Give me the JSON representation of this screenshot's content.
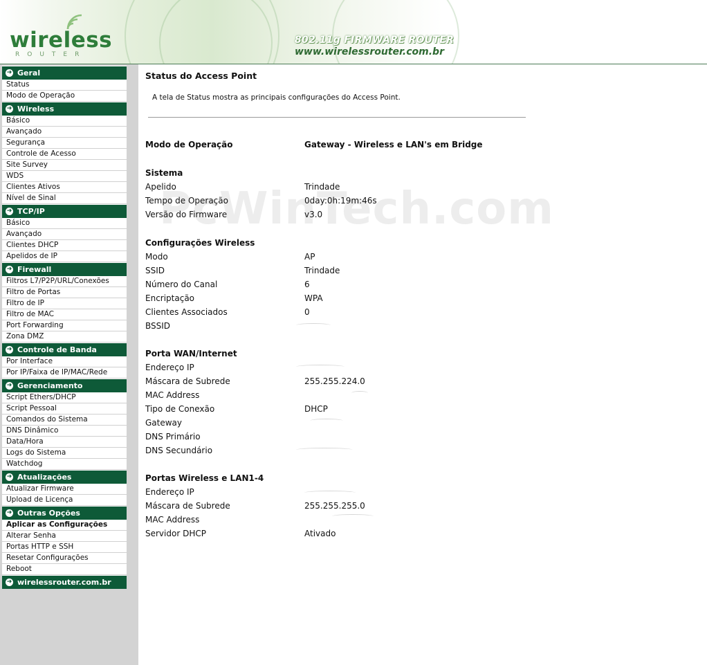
{
  "header": {
    "logo_word": "wireless",
    "logo_sub": "ROUTER",
    "firmware_title": "802.11g FIRMWARE ROUTER",
    "firmware_url": "www.wirelessrouter.com.br"
  },
  "sidebar": {
    "sections": [
      {
        "title": "Geral",
        "items": [
          "Status",
          "Modo de Operação"
        ]
      },
      {
        "title": "Wireless",
        "items": [
          "Básico",
          "Avançado",
          "Segurança",
          "Controle de Acesso",
          "Site Survey",
          "WDS",
          "Clientes Ativos",
          "Nível de Sinal"
        ]
      },
      {
        "title": "TCP/IP",
        "items": [
          "Básico",
          "Avançado",
          "Clientes DHCP",
          "Apelidos de IP"
        ]
      },
      {
        "title": "Firewall",
        "items": [
          "Filtros L7/P2P/URL/Conexões",
          "Filtro de Portas",
          "Filtro de IP",
          "Filtro de MAC",
          "Port Forwarding",
          "Zona DMZ"
        ]
      },
      {
        "title": "Controle de Banda",
        "items": [
          "Por Interface",
          "Por IP/Faixa de IP/MAC/Rede"
        ]
      },
      {
        "title": "Gerenciamento",
        "items": [
          "Script Ethers/DHCP",
          "Script Pessoal",
          "Comandos do Sistema",
          "DNS Dinâmico",
          "Data/Hora",
          "Logs do Sistema",
          "Watchdog"
        ]
      },
      {
        "title": "Atualizações",
        "items": [
          "Atualizar Firmware",
          "Upload de Licença"
        ]
      },
      {
        "title": "Outras Opções",
        "items": [
          "Aplicar as Configurações",
          "Alterar Senha",
          "Portas HTTP e SSH",
          "Resetar Configurações",
          "Reboot"
        ]
      },
      {
        "title": "wirelessrouter.com.br",
        "items": []
      }
    ],
    "active_item": "Aplicar as Configurações"
  },
  "main": {
    "title": "Status do Access Point",
    "description": "A tela de Status mostra as principais configurações do Access Point.",
    "watermark": "PcWinTech.com",
    "mode": {
      "label": "Modo de Operação",
      "value": "Gateway - Wireless e LAN's em Bridge"
    },
    "sistema": {
      "heading": "Sistema",
      "rows": [
        {
          "label": "Apelido",
          "value": "Trindade"
        },
        {
          "label": "Tempo de Operação",
          "value": "0day:0h:19m:46s"
        },
        {
          "label": "Versão do Firmware",
          "value": "v3.0"
        }
      ]
    },
    "wireless": {
      "heading": "Configurações Wireless",
      "rows": [
        {
          "label": "Modo",
          "value": "AP"
        },
        {
          "label": "SSID",
          "value": "Trindade"
        },
        {
          "label": "Número do Canal",
          "value": "6"
        },
        {
          "label": "Encriptação",
          "value": "WPA"
        },
        {
          "label": "Clientes Associados",
          "value": "0"
        },
        {
          "label": "BSSID",
          "value": ""
        }
      ]
    },
    "wan": {
      "heading": "Porta WAN/Internet",
      "rows": [
        {
          "label": "Endereço IP",
          "value": ""
        },
        {
          "label": "Máscara de Subrede",
          "value": "255.255.224.0"
        },
        {
          "label": "MAC Address",
          "value": ""
        },
        {
          "label": "Tipo de Conexão",
          "value": "DHCP"
        },
        {
          "label": "Gateway",
          "value": ""
        },
        {
          "label": "DNS Primário",
          "value": ""
        },
        {
          "label": "DNS Secundário",
          "value": ""
        }
      ]
    },
    "lan": {
      "heading": "Portas Wireless e LAN1-4",
      "rows": [
        {
          "label": "Endereço IP",
          "value": ""
        },
        {
          "label": "Máscara de Subrede",
          "value": "255.255.255.0"
        },
        {
          "label": "MAC Address",
          "value": ""
        },
        {
          "label": "Servidor DHCP",
          "value": "Ativado"
        }
      ]
    }
  }
}
